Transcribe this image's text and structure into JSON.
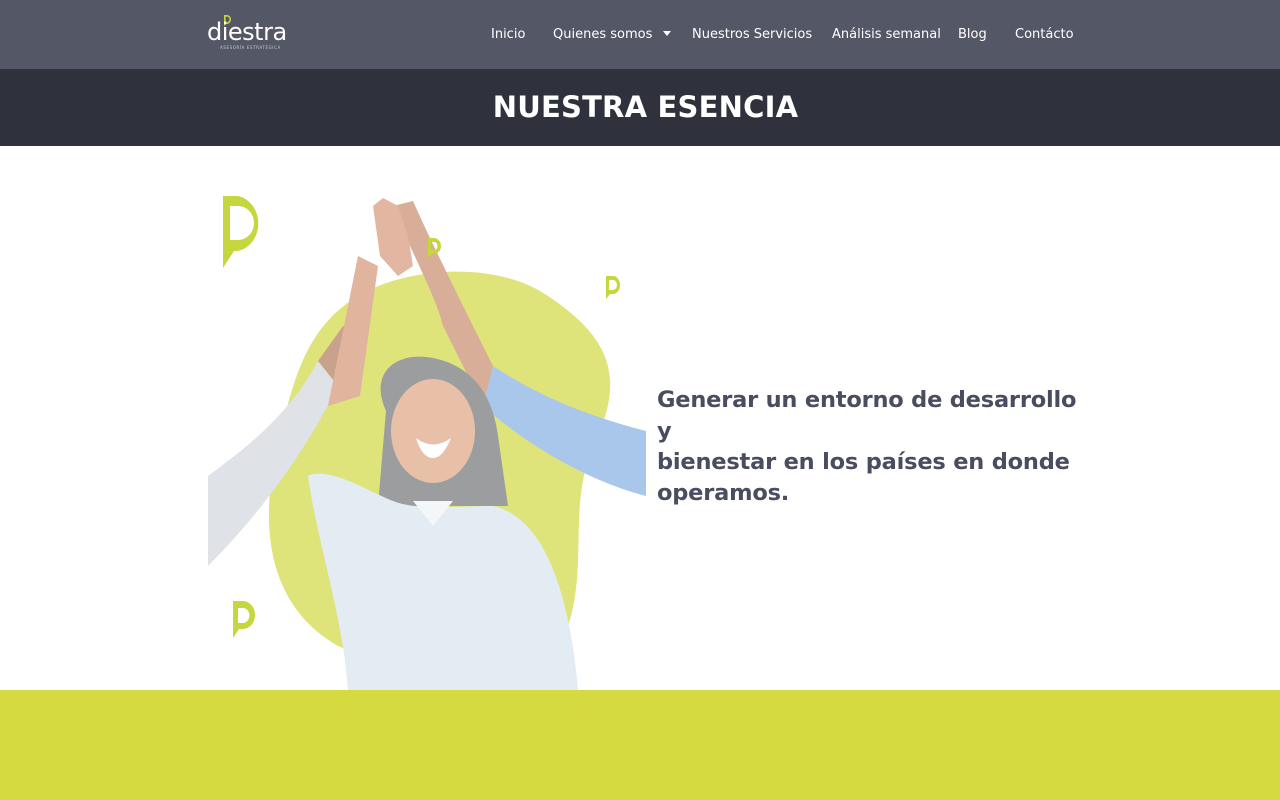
{
  "brand": {
    "name": "diestra",
    "tagline": "ASESORÍA ESTRATÉGICA"
  },
  "nav": {
    "items": [
      {
        "label": "Inicio"
      },
      {
        "label": "Quienes somos"
      },
      {
        "label": "Nuestros Servicios"
      },
      {
        "label": "Análisis semanal"
      },
      {
        "label": "Blog"
      },
      {
        "label": "Contácto"
      }
    ]
  },
  "page": {
    "title": "NUESTRA ESENCIA"
  },
  "mission": {
    "text": "Generar un entorno de desarrollo y\nbienestar  en los países en donde\noperamos."
  },
  "colors": {
    "nav_bg": "#545766",
    "title_band_bg": "#2f323c",
    "accent_lime": "#d4da3f",
    "text_dark": "#4a4c60"
  },
  "icons": [
    "caret-down-icon",
    "brand-d-icon"
  ]
}
